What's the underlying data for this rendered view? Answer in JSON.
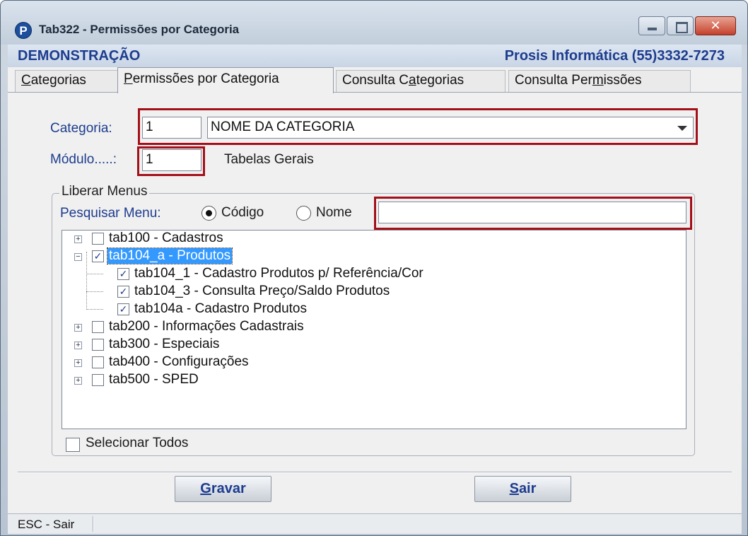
{
  "window": {
    "title": "Tab322 - Permissões por Categoria",
    "app_icon": "P",
    "close_glyph": "✕"
  },
  "brandbar": {
    "left": "DEMONSTRAÇÃO",
    "right": "Prosis Informática (55)3332-7273"
  },
  "tabs": [
    {
      "label": "Categorias",
      "accel": "C",
      "rest": "ategorias",
      "active": false
    },
    {
      "label": "Permissões por Categoria",
      "accel": "P",
      "rest": "ermissões por Categoria",
      "active": true
    },
    {
      "label": "Consulta Categorias",
      "pre": "Consulta C",
      "accel": "a",
      "rest": "tegorias",
      "active": false
    },
    {
      "label": "Consulta Permissões",
      "pre": "Consulta Per",
      "accel": "m",
      "rest": "issões",
      "active": false
    }
  ],
  "form": {
    "categoria_label": "Categoria:",
    "categoria_code": "1",
    "categoria_name": "NOME DA CATEGORIA",
    "modulo_label": "Módulo.....:",
    "modulo_code": "1",
    "modulo_name": "Tabelas Gerais"
  },
  "group": {
    "legend": "Liberar Menus",
    "search_label": "Pesquisar Menu:",
    "radio_codigo": "Código",
    "radio_nome": "Nome",
    "search_value": "",
    "selected_radio": "codigo"
  },
  "tree": [
    {
      "text": "tab100 - Cadastros",
      "level": 0,
      "expander": "+",
      "checked": false,
      "selected": false
    },
    {
      "text": "tab104_a - Produtos",
      "level": 0,
      "expander": "−",
      "checked": true,
      "selected": true
    },
    {
      "text": "tab104_1 - Cadastro Produtos p/ Referência/Cor",
      "level": 1,
      "expander": "",
      "checked": true,
      "selected": false
    },
    {
      "text": "tab104_3 - Consulta Preço/Saldo Produtos",
      "level": 1,
      "expander": "",
      "checked": true,
      "selected": false
    },
    {
      "text": "tab104a - Cadastro Produtos",
      "level": 1,
      "expander": "",
      "checked": true,
      "selected": false
    },
    {
      "text": "tab200 - Informações Cadastrais",
      "level": 0,
      "expander": "+",
      "checked": false,
      "selected": false
    },
    {
      "text": "tab300 - Especiais",
      "level": 0,
      "expander": "+",
      "checked": false,
      "selected": false
    },
    {
      "text": "tab400 - Configurações",
      "level": 0,
      "expander": "+",
      "checked": false,
      "selected": false
    },
    {
      "text": "tab500 - SPED",
      "level": 0,
      "expander": "+",
      "checked": false,
      "selected": false
    }
  ],
  "select_all": {
    "label": "Selecionar Todos",
    "checked": false
  },
  "buttons": {
    "gravar": {
      "accel": "G",
      "rest": "ravar"
    },
    "sair": {
      "accel": "S",
      "rest": "air"
    }
  },
  "status": {
    "text": "ESC - Sair"
  },
  "colors": {
    "accent": "#1d3c8e",
    "highlight": "#a3101a",
    "selection": "#3399ff"
  }
}
